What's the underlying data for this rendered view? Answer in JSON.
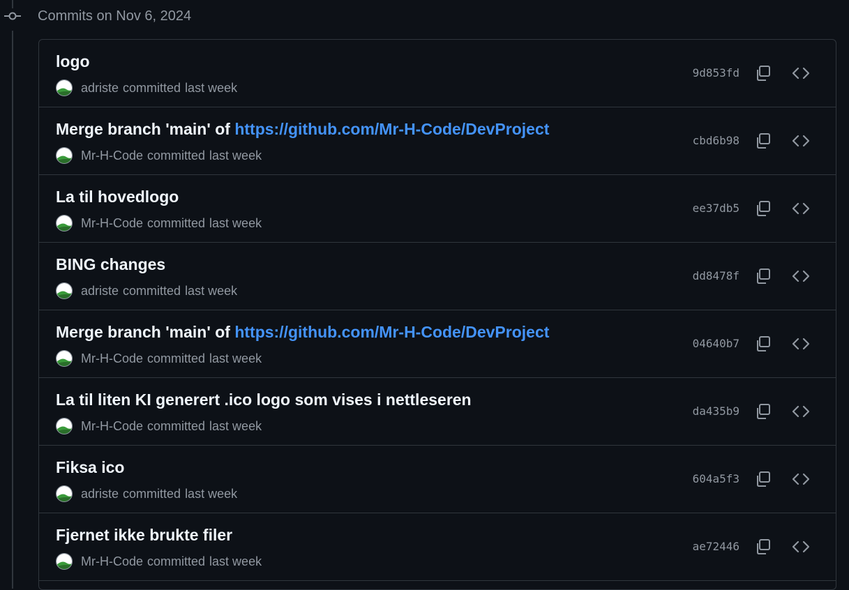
{
  "group": {
    "title": "Commits on Nov 6, 2024"
  },
  "commits": [
    {
      "title": "logo",
      "link": "",
      "author": "adriste",
      "action": "committed",
      "time": "last week",
      "sha": "9d853fd"
    },
    {
      "title": "Merge branch 'main' of ",
      "link": "https://github.com/Mr-H-Code/DevProject",
      "author": "Mr-H-Code",
      "action": "committed",
      "time": "last week",
      "sha": "cbd6b98"
    },
    {
      "title": "La til hovedlogo",
      "link": "",
      "author": "Mr-H-Code",
      "action": "committed",
      "time": "last week",
      "sha": "ee37db5"
    },
    {
      "title": "BING changes",
      "link": "",
      "author": "adriste",
      "action": "committed",
      "time": "last week",
      "sha": "dd8478f"
    },
    {
      "title": "Merge branch 'main' of ",
      "link": "https://github.com/Mr-H-Code/DevProject",
      "author": "Mr-H-Code",
      "action": "committed",
      "time": "last week",
      "sha": "04640b7"
    },
    {
      "title": "La til liten KI generert .ico logo som vises i nettleseren",
      "link": "",
      "author": "Mr-H-Code",
      "action": "committed",
      "time": "last week",
      "sha": "da435b9"
    },
    {
      "title": "Fiksa ico",
      "link": "",
      "author": "adriste",
      "action": "committed",
      "time": "last week",
      "sha": "604a5f3"
    },
    {
      "title": "Fjernet ikke brukte filer",
      "link": "",
      "author": "Mr-H-Code",
      "action": "committed",
      "time": "last week",
      "sha": "ae72446"
    }
  ],
  "colors": {
    "background": "#0d1117",
    "border": "#30363d",
    "text_primary": "#f0f6fc",
    "text_muted": "#9198a1",
    "link": "#4493f8"
  },
  "icons": {
    "group_node": "git-commit-icon",
    "copy": "copy-icon",
    "browse": "code-icon",
    "avatar": "avatar-image"
  }
}
